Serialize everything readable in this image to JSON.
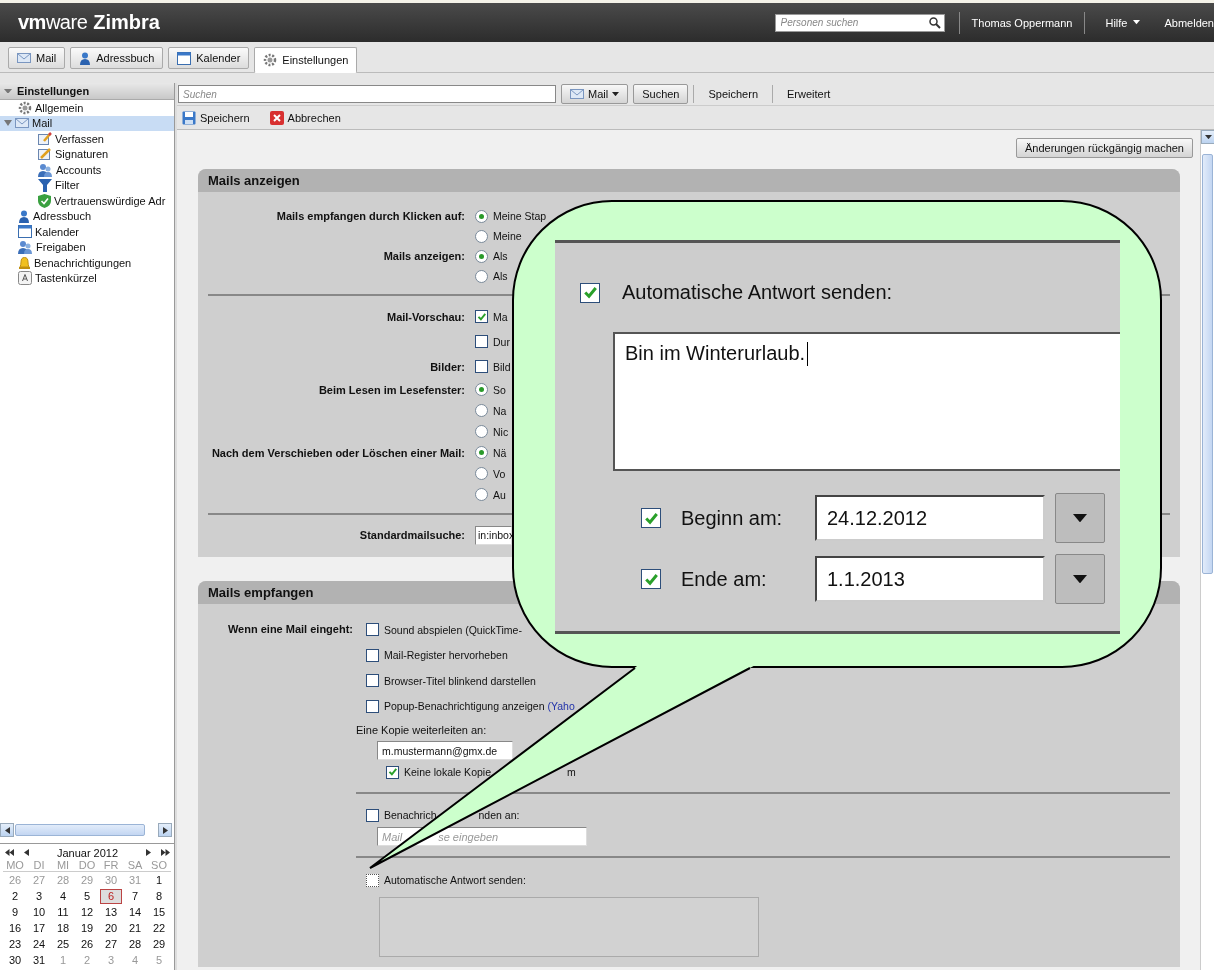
{
  "header": {
    "logo_brand": "**vm**ware",
    "logo_product": "Zimbra",
    "people_search": {
      "placeholder": "Personen suchen"
    },
    "user": "Thomas Oppermann",
    "help": "Hilfe",
    "logout": "Abmelden"
  },
  "app_tabs": [
    {
      "label": "Mail",
      "selected": false
    },
    {
      "label": "Adressbuch",
      "selected": false
    },
    {
      "label": "Kalender",
      "selected": false
    },
    {
      "label": "Einstellungen",
      "selected": true
    }
  ],
  "sidebar": {
    "title": "Einstellungen",
    "items": [
      {
        "label": "Allgemein",
        "selected": false
      },
      {
        "label": "Mail",
        "selected": true,
        "expanded": true,
        "children": [
          {
            "label": "Verfassen",
            "selected": false
          },
          {
            "label": "Signaturen",
            "selected": false
          },
          {
            "label": "Accounts",
            "selected": false
          },
          {
            "label": "Filter",
            "selected": false
          },
          {
            "label": "Vertrauenswürdige Adr",
            "selected": false
          }
        ]
      },
      {
        "label": "Adressbuch",
        "selected": false
      },
      {
        "label": "Kalender",
        "selected": false
      },
      {
        "label": "Freigaben",
        "selected": false
      },
      {
        "label": "Benachrichtigungen",
        "selected": false
      },
      {
        "label": "Tastenkürzel",
        "selected": false
      }
    ]
  },
  "mini_calendar": {
    "title": "Januar 2012",
    "weekdays": [
      "MO",
      "DI",
      "MI",
      "DO",
      "FR",
      "SA",
      "SO"
    ],
    "weeks": [
      [
        {
          "day": "26",
          "other_month": true,
          "selected": false
        },
        {
          "day": "27",
          "other_month": true,
          "selected": false
        },
        {
          "day": "28",
          "other_month": true,
          "selected": false
        },
        {
          "day": "29",
          "other_month": true,
          "selected": false
        },
        {
          "day": "30",
          "other_month": true,
          "selected": false
        },
        {
          "day": "31",
          "other_month": true,
          "selected": false
        },
        {
          "day": "1",
          "other_month": false,
          "selected": false
        }
      ],
      [
        {
          "day": "2",
          "other_month": false,
          "selected": false
        },
        {
          "day": "3",
          "other_month": false,
          "selected": false
        },
        {
          "day": "4",
          "other_month": false,
          "selected": false
        },
        {
          "day": "5",
          "other_month": false,
          "selected": false
        },
        {
          "day": "6",
          "other_month": false,
          "selected": true
        },
        {
          "day": "7",
          "other_month": false,
          "selected": false
        },
        {
          "day": "8",
          "other_month": false,
          "selected": false
        }
      ],
      [
        {
          "day": "9",
          "other_month": false,
          "selected": false
        },
        {
          "day": "10",
          "other_month": false,
          "selected": false
        },
        {
          "day": "11",
          "other_month": false,
          "selected": false
        },
        {
          "day": "12",
          "other_month": false,
          "selected": false
        },
        {
          "day": "13",
          "other_month": false,
          "selected": false
        },
        {
          "day": "14",
          "other_month": false,
          "selected": false
        },
        {
          "day": "15",
          "other_month": false,
          "selected": false
        }
      ],
      [
        {
          "day": "16",
          "other_month": false,
          "selected": false
        },
        {
          "day": "17",
          "other_month": false,
          "selected": false
        },
        {
          "day": "18",
          "other_month": false,
          "selected": false
        },
        {
          "day": "19",
          "other_month": false,
          "selected": false
        },
        {
          "day": "20",
          "other_month": false,
          "selected": false
        },
        {
          "day": "21",
          "other_month": false,
          "selected": false
        },
        {
          "day": "22",
          "other_month": false,
          "selected": false
        }
      ],
      [
        {
          "day": "23",
          "other_month": false,
          "selected": false
        },
        {
          "day": "24",
          "other_month": false,
          "selected": false
        },
        {
          "day": "25",
          "other_month": false,
          "selected": false
        },
        {
          "day": "26",
          "other_month": false,
          "selected": false
        },
        {
          "day": "27",
          "other_month": false,
          "selected": false
        },
        {
          "day": "28",
          "other_month": false,
          "selected": false
        },
        {
          "day": "29",
          "other_month": false,
          "selected": false
        }
      ],
      [
        {
          "day": "30",
          "other_month": false,
          "selected": false
        },
        {
          "day": "31",
          "other_month": false,
          "selected": false
        },
        {
          "day": "1",
          "other_month": true,
          "selected": false
        },
        {
          "day": "2",
          "other_month": true,
          "selected": false
        },
        {
          "day": "3",
          "other_month": true,
          "selected": false
        },
        {
          "day": "4",
          "other_month": true,
          "selected": false
        },
        {
          "day": "5",
          "other_month": true,
          "selected": false
        }
      ]
    ]
  },
  "search_bar": {
    "placeholder": "Suchen",
    "scope": "Mail",
    "search": "Suchen",
    "save": "Speichern",
    "advanced": "Erweitert"
  },
  "toolbar": {
    "save": "Speichern",
    "cancel": "Abbrechen"
  },
  "undo_button": "Änderungen rückgängig machen",
  "display_section": {
    "title": "Mails anzeigen",
    "groups": [
      [
        {
          "label": "Mails empfangen durch Klicken auf:",
          "kind": "radio",
          "text": "Meine Stap",
          "selected": true
        },
        {
          "kind": "radio",
          "text": "Meine",
          "selected": false
        },
        {
          "label": "Mails anzeigen:",
          "kind": "radio",
          "text": "Als",
          "selected": true
        },
        {
          "kind": "radio",
          "text": "Als",
          "selected": false
        }
      ],
      [
        {
          "label": "Mail-Vorschau:",
          "kind": "checkbox",
          "text": "Ma",
          "checked": true
        },
        {
          "kind": "checkbox",
          "text": "Dur",
          "checked": false
        },
        {
          "label": "Bilder:",
          "kind": "checkbox",
          "text": "Bild",
          "checked": false
        },
        {
          "label": "Beim Lesen im Lesefenster:",
          "kind": "radio",
          "text": "So",
          "selected": true
        },
        {
          "kind": "radio",
          "text": "Na",
          "selected": false
        },
        {
          "kind": "radio",
          "text": "Nic",
          "selected": false
        },
        {
          "label": "Nach dem Verschieben oder Löschen einer Mail:",
          "kind": "radio",
          "text": "Nä",
          "selected": true
        },
        {
          "kind": "radio",
          "text": "Vo",
          "selected": false
        },
        {
          "kind": "radio",
          "text": "Au",
          "selected": false
        }
      ],
      [
        {
          "label": "Standardmailsuche:",
          "kind": "field",
          "value": "in:inbox"
        }
      ]
    ]
  },
  "receive_section": {
    "title": "Mails empfangen",
    "notify_label": "Wenn eine Mail eingeht:",
    "notify_options": [
      {
        "text": "Sound abspielen (QuickTime-",
        "checked": false
      },
      {
        "text": "Mail-Register hervorheben",
        "checked": false
      },
      {
        "text": "Browser-Titel blinkend darstellen",
        "checked": false
      },
      {
        "text": "Popup-Benachrichtigung anzeigen",
        "link": "(Yaho",
        "checked": false
      }
    ],
    "forward": {
      "label": "Eine Kopie weiterleiten an:",
      "value": "m.mustermann@gmx.de",
      "no_local_copy": {
        "text": "Keine lokale Kopie",
        "text_after": "m",
        "checked": true
      }
    },
    "notification": {
      "text": "Benachrich",
      "text_after": "nden an:",
      "checked": false,
      "placeholder": "Mail",
      "placeholder_after": "se eingeben"
    },
    "auto_reply": {
      "text": "Automatische Antwort senden:",
      "checked": false
    }
  },
  "callout": {
    "auto_reply": {
      "text": "Automatische Antwort senden:",
      "checked": true
    },
    "message": "Bin im Winterurlaub.",
    "dates": [
      {
        "label": "Beginn am:",
        "checked": true,
        "value": "24.12.2012"
      },
      {
        "label": "Ende am:",
        "checked": true,
        "value": "1.1.2013"
      }
    ]
  }
}
